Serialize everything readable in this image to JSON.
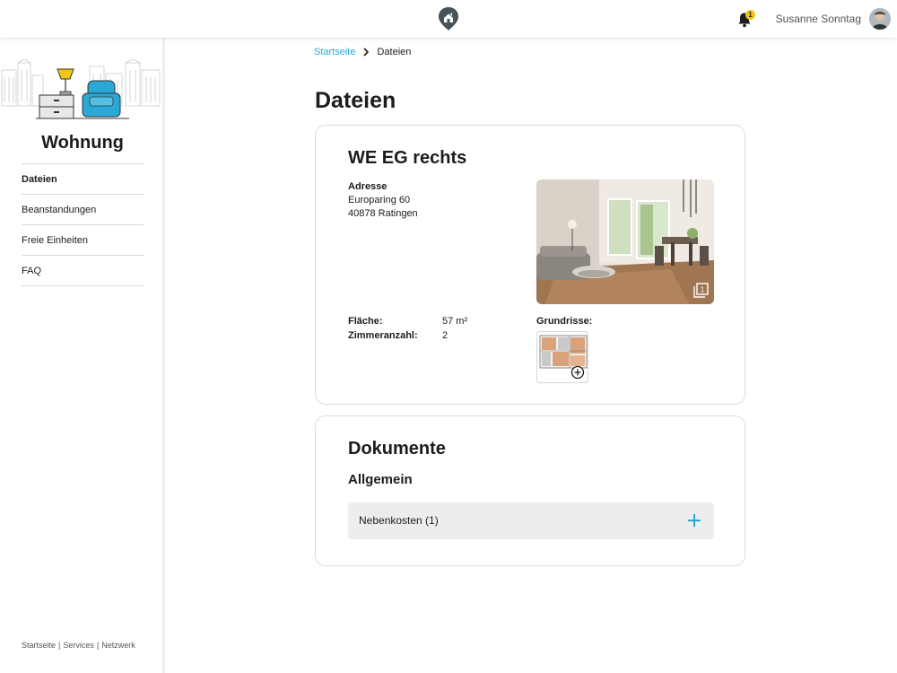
{
  "header": {
    "logo_icon": "house-pin-icon",
    "notification_count": "1",
    "user_name": "Susanne Sonntag"
  },
  "sidebar": {
    "title": "Wohnung",
    "items": [
      {
        "label": "Dateien",
        "active": true
      },
      {
        "label": "Beanstandungen",
        "active": false
      },
      {
        "label": "Freie Einheiten",
        "active": false
      },
      {
        "label": "FAQ",
        "active": false
      }
    ],
    "footer_links": [
      "Startseite",
      "Services",
      "Netzwerk"
    ]
  },
  "breadcrumb": {
    "home": "Startseite",
    "current": "Dateien"
  },
  "page_title": "Dateien",
  "unit_card": {
    "name": "WE EG rechts",
    "address_label": "Adresse",
    "address_line1": "Europaring 60",
    "address_line2": "40878 Ratingen",
    "area_label": "Fläche:",
    "area_value": "57 m²",
    "rooms_label": "Zimmeranzahl:",
    "rooms_value": "2",
    "floorplans_label": "Grundrisse:",
    "photo_count_icon": "gallery-count-icon",
    "photo_count": "1"
  },
  "documents_card": {
    "title": "Dokumente",
    "section": "Allgemein",
    "accordion_label": "Nebenkosten (1)"
  },
  "colors": {
    "accent": "#2aa8d8",
    "badge": "#f3c613",
    "logo": "#46535a",
    "accordion_bg": "#ededee"
  }
}
